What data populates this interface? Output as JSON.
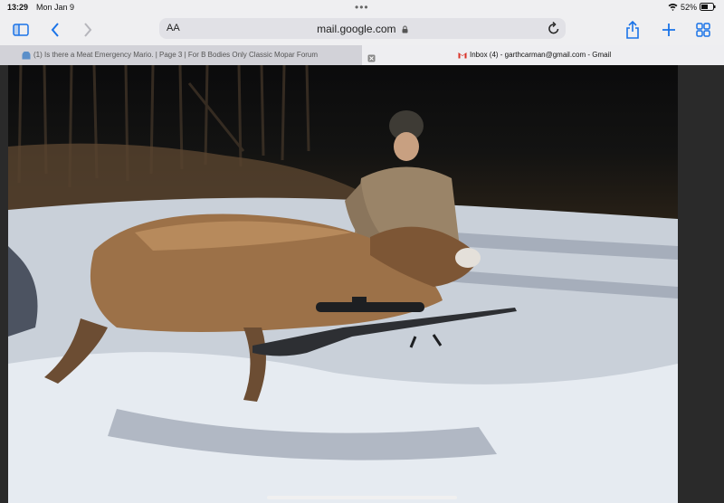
{
  "status_bar": {
    "time": "13:29",
    "date": "Mon Jan 9",
    "battery_percent": "52%"
  },
  "toolbar": {
    "text_size_label": "AA",
    "address": "mail.google.com"
  },
  "tabs": [
    {
      "title": "(1) Is there a Meat Emergency Mario. | Page 3 | For B Bodies Only Classic Mopar Forum",
      "active": false
    },
    {
      "title": "Inbox (4) - garthcarman@gmail.com - Gmail",
      "active": true
    }
  ],
  "colors": {
    "accent": "#1a73e8",
    "gmail_red": "#d93025"
  }
}
